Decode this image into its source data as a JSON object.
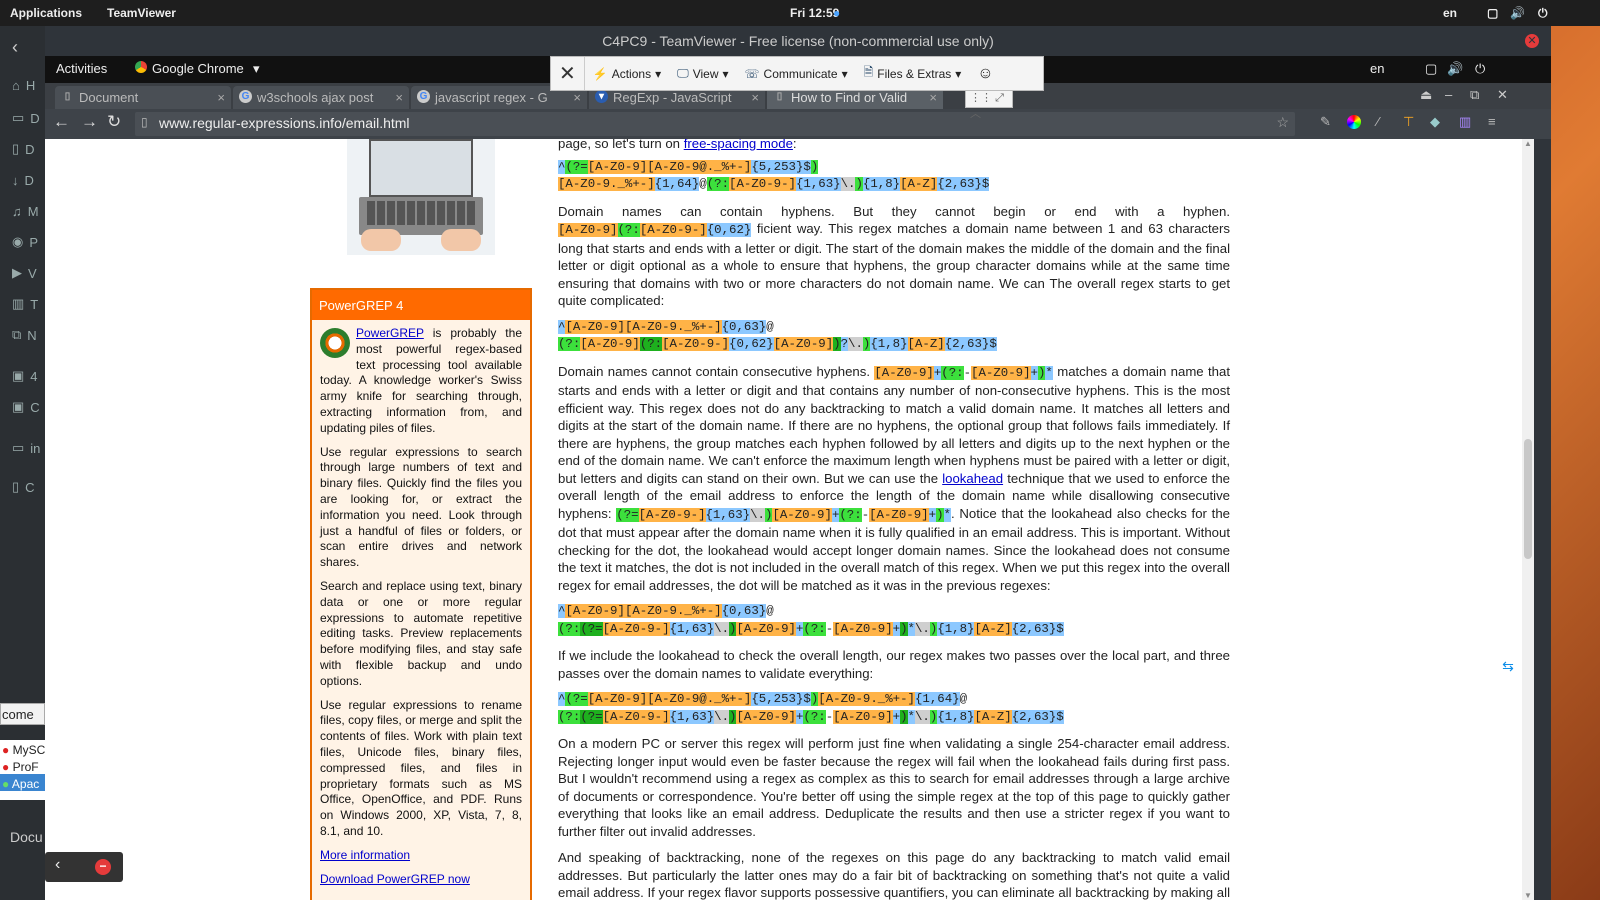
{
  "os_bar": {
    "applications": "Applications",
    "teamviewer": "TeamViewer",
    "clock": "Fri 12:59",
    "lang": "en"
  },
  "dock": {
    "items": [
      "H",
      "D",
      "D",
      "D",
      "M",
      "P",
      "V",
      "T",
      "N",
      "4",
      "C",
      "in",
      "C"
    ],
    "bottom_items": [
      "come",
      "MySC",
      "ProF",
      "Apac",
      "Docu"
    ]
  },
  "teamviewer": {
    "title": "C4PC9 - TeamViewer - Free license (non-commercial use only)",
    "toolbar": {
      "actions": "Actions",
      "view": "View",
      "communicate": "Communicate",
      "files": "Files & Extras"
    }
  },
  "gnome_panel": {
    "activities": "Activities",
    "app": "Google Chrome",
    "lang": "en"
  },
  "tabs": [
    {
      "label": "Document"
    },
    {
      "label": "w3schools ajax post"
    },
    {
      "label": "javascript regex - G"
    },
    {
      "label": "RegExp - JavaScript"
    },
    {
      "label": "How to Find or Valid"
    }
  ],
  "url": "www.regular-expressions.info/email.html",
  "sidebar": {
    "title": "PowerGREP 4",
    "link": "PowerGREP",
    "p1": " is probably the most powerful regex-based text processing tool available today. A knowledge worker's Swiss army knife for searching through, extracting information from, and updating piles of files.",
    "p2": "Use regular expressions to search through large numbers of text and binary files. Quickly find the files you are looking for, or extract the information you need. Look through just a handful of files or folders, or scan entire drives and network shares.",
    "p3": "Search and replace using text, binary data or one or more regular expressions to automate repetitive editing tasks. Preview replacements before modifying files, and stay safe with flexible backup and undo options.",
    "p4": "Use regular expressions to rename files, copy files, or merge and split the contents of files. Work with plain text files, Unicode files, binary files, compressed files, and files in proprietary formats such as MS Office, OpenOffice, and PDF. Runs on Windows 2000, XP, Vista, 7, 8, 8.1, and 10.",
    "more": "More information",
    "download": "Download PowerGREP now"
  },
  "content": {
    "intro_pre": "page, so let's turn on ",
    "intro_link": "free-spacing mode",
    "intro_post": ":",
    "p_hyphens": "Domain names can contain hyphens. But they cannot begin or end with a hyphen.",
    "p_hyphens2": "ficient way. This regex matches a domain name between 1 and 63 characters long that starts and ends with a letter or digit. The start of the domain makes the middle of the domain and the final letter or digit optional as a whole to ensure that hyphens, the group character domains while at the same time ensuring that domains with two or more characters do not domain name. We can The overall regex starts to get quite complicated:",
    "p_consec1": "Domain names cannot contain consecutive hyphens.",
    "p_consec2": "matches a domain name that starts and ends with a letter or digit and that contains any number of non-consecutive hyphens. This is the most efficient way. This regex does not do any backtracking to match a valid domain name. It matches all letters and digits at the start of the domain name. If there are no hyphens, the optional group that follows fails immediately. If there are hyphens, the group matches each hyphen followed by all letters and digits up to the next hyphen or the end of the domain name. We can't enforce the maximum length when hyphens must be paired with a letter or digit, but letters and digits can stand on their own. But we can use the ",
    "lookahead": "lookahead",
    "p_consec3": " technique that we used to enforce the overall length of the email address to enforce the length of the domain name while disallowing consecutive hyphens:",
    "p_consec4": ". Notice that the lookahead also checks for the dot that must appear after the domain name when it is fully qualified in an email address. This is important. Without checking for the dot, the lookahead would accept longer domain names. Since the lookahead does not consume the text it matches, the dot is not included in the overall match of this regex. When we put this regex into the overall regex for email addresses, the dot will be matched as it was in the previous regexes:",
    "p_include": "If we include the lookahead to check the overall length, our regex makes two passes over the local part, and three passes over the domain names to validate everything:",
    "p_modern": "On a modern PC or server this regex will perform just fine when validating a single 254-character email address. Rejecting longer input would even be faster because the regex will fail when the lookahead fails during first pass. But I wouldn't recommend using a regex as complex as this to search for email addresses through a large archive of documents or correspondence. You're better off using the simple regex at the top of this page to quickly gather everything that looks like an email address. Deduplicate the results and then use a stricter regex if you want to further filter out invalid addresses.",
    "p_backtrack": "And speaking of backtracking, none of the regexes on this page do any backtracking to match valid email addresses. But particularly the latter ones may do a fair bit of backtracking on something that's not quite a valid email address. If your regex flavor supports possessive quantifiers, you can eliminate all backtracking by making all quantifiers"
  },
  "colors": {
    "orange": "#ff6a00",
    "link": "#0000cc"
  }
}
